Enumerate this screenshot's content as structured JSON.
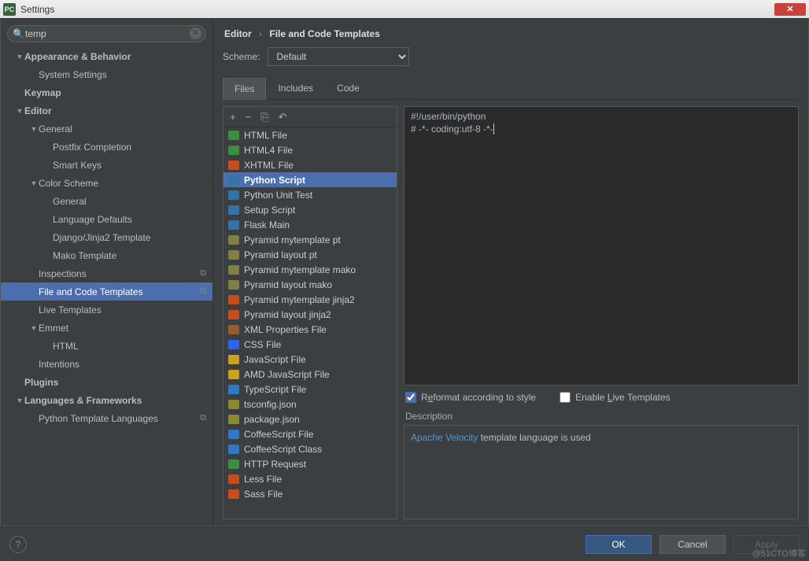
{
  "window": {
    "title": "Settings"
  },
  "search": {
    "value": "temp"
  },
  "sidebar": [
    {
      "label": "Appearance & Behavior",
      "indent": 1,
      "bold": true,
      "tw": "▼"
    },
    {
      "label": "System Settings",
      "indent": 2
    },
    {
      "label": "Keymap",
      "indent": 1,
      "bold": true
    },
    {
      "label": "Editor",
      "indent": 1,
      "bold": true,
      "tw": "▼"
    },
    {
      "label": "General",
      "indent": 2,
      "tw": "▼"
    },
    {
      "label": "Postfix Completion",
      "indent": 3
    },
    {
      "label": "Smart Keys",
      "indent": 3
    },
    {
      "label": "Color Scheme",
      "indent": 2,
      "tw": "▼"
    },
    {
      "label": "General",
      "indent": 3
    },
    {
      "label": "Language Defaults",
      "indent": 3
    },
    {
      "label": "Django/Jinja2 Template",
      "indent": 3
    },
    {
      "label": "Mako Template",
      "indent": 3
    },
    {
      "label": "Inspections",
      "indent": 2,
      "badge": "�ので"
    },
    {
      "label": "File and Code Templates",
      "indent": 2,
      "selected": true,
      "badge": "�ので"
    },
    {
      "label": "Live Templates",
      "indent": 2
    },
    {
      "label": "Emmet",
      "indent": 2,
      "tw": "▼"
    },
    {
      "label": "HTML",
      "indent": 3
    },
    {
      "label": "Intentions",
      "indent": 2
    },
    {
      "label": "Plugins",
      "indent": 1,
      "bold": true
    },
    {
      "label": "Languages & Frameworks",
      "indent": 1,
      "bold": true,
      "tw": "▼"
    },
    {
      "label": "Python Template Languages",
      "indent": 2,
      "badge": "�ので"
    }
  ],
  "breadcrumb": {
    "a": "Editor",
    "b": "File and Code Templates"
  },
  "scheme": {
    "label": "Scheme:",
    "value": "Default"
  },
  "tabs": [
    {
      "label": "Files",
      "active": true
    },
    {
      "label": "Includes"
    },
    {
      "label": "Code"
    }
  ],
  "toolbar": {
    "add": "+",
    "remove": "−",
    "copy": "⎘",
    "revert": "↶"
  },
  "templates": [
    {
      "label": "HTML File",
      "color": "#3c8f3c"
    },
    {
      "label": "HTML4 File",
      "color": "#3c8f3c"
    },
    {
      "label": "XHTML File",
      "color": "#c74d1c"
    },
    {
      "label": "Python Script",
      "color": "#3572A5",
      "selected": true
    },
    {
      "label": "Python Unit Test",
      "color": "#3572A5"
    },
    {
      "label": "Setup Script",
      "color": "#3572A5"
    },
    {
      "label": "Flask Main",
      "color": "#3572A5"
    },
    {
      "label": "Pyramid mytemplate pt",
      "color": "#7f7f46"
    },
    {
      "label": "Pyramid layout pt",
      "color": "#7f7f46"
    },
    {
      "label": "Pyramid mytemplate mako",
      "color": "#7f7f46"
    },
    {
      "label": "Pyramid layout mako",
      "color": "#7f7f46"
    },
    {
      "label": "Pyramid mytemplate jinja2",
      "color": "#c74d1c"
    },
    {
      "label": "Pyramid layout jinja2",
      "color": "#c74d1c"
    },
    {
      "label": "XML Properties File",
      "color": "#955c2e"
    },
    {
      "label": "CSS File",
      "color": "#2965f1"
    },
    {
      "label": "JavaScript File",
      "color": "#cba120"
    },
    {
      "label": "AMD JavaScript File",
      "color": "#cba120"
    },
    {
      "label": "TypeScript File",
      "color": "#3178c6"
    },
    {
      "label": "tsconfig.json",
      "color": "#8a8a35"
    },
    {
      "label": "package.json",
      "color": "#8a8a35"
    },
    {
      "label": "CoffeeScript File",
      "color": "#3178c6"
    },
    {
      "label": "CoffeeScript Class",
      "color": "#3178c6"
    },
    {
      "label": "HTTP Request",
      "color": "#3c8f3c"
    },
    {
      "label": "Less File",
      "color": "#c74d1c"
    },
    {
      "label": "Sass File",
      "color": "#c74d1c"
    }
  ],
  "editor": {
    "line1": "#!/user/bin/python",
    "line2": "# -*- coding:utf-8 -*-"
  },
  "options": {
    "reformat": {
      "label_pre": "R",
      "label_ul": "e",
      "label_post": "format according to style",
      "checked": true
    },
    "live": {
      "label_pre": "Enable ",
      "label_ul": "L",
      "label_post": "ive Templates",
      "checked": false
    }
  },
  "description": {
    "label": "Description",
    "link": "Apache Velocity",
    "text": " template language is used"
  },
  "footer": {
    "ok": "OK",
    "cancel": "Cancel",
    "apply": "Apply"
  },
  "watermark": "@51CTO博客"
}
